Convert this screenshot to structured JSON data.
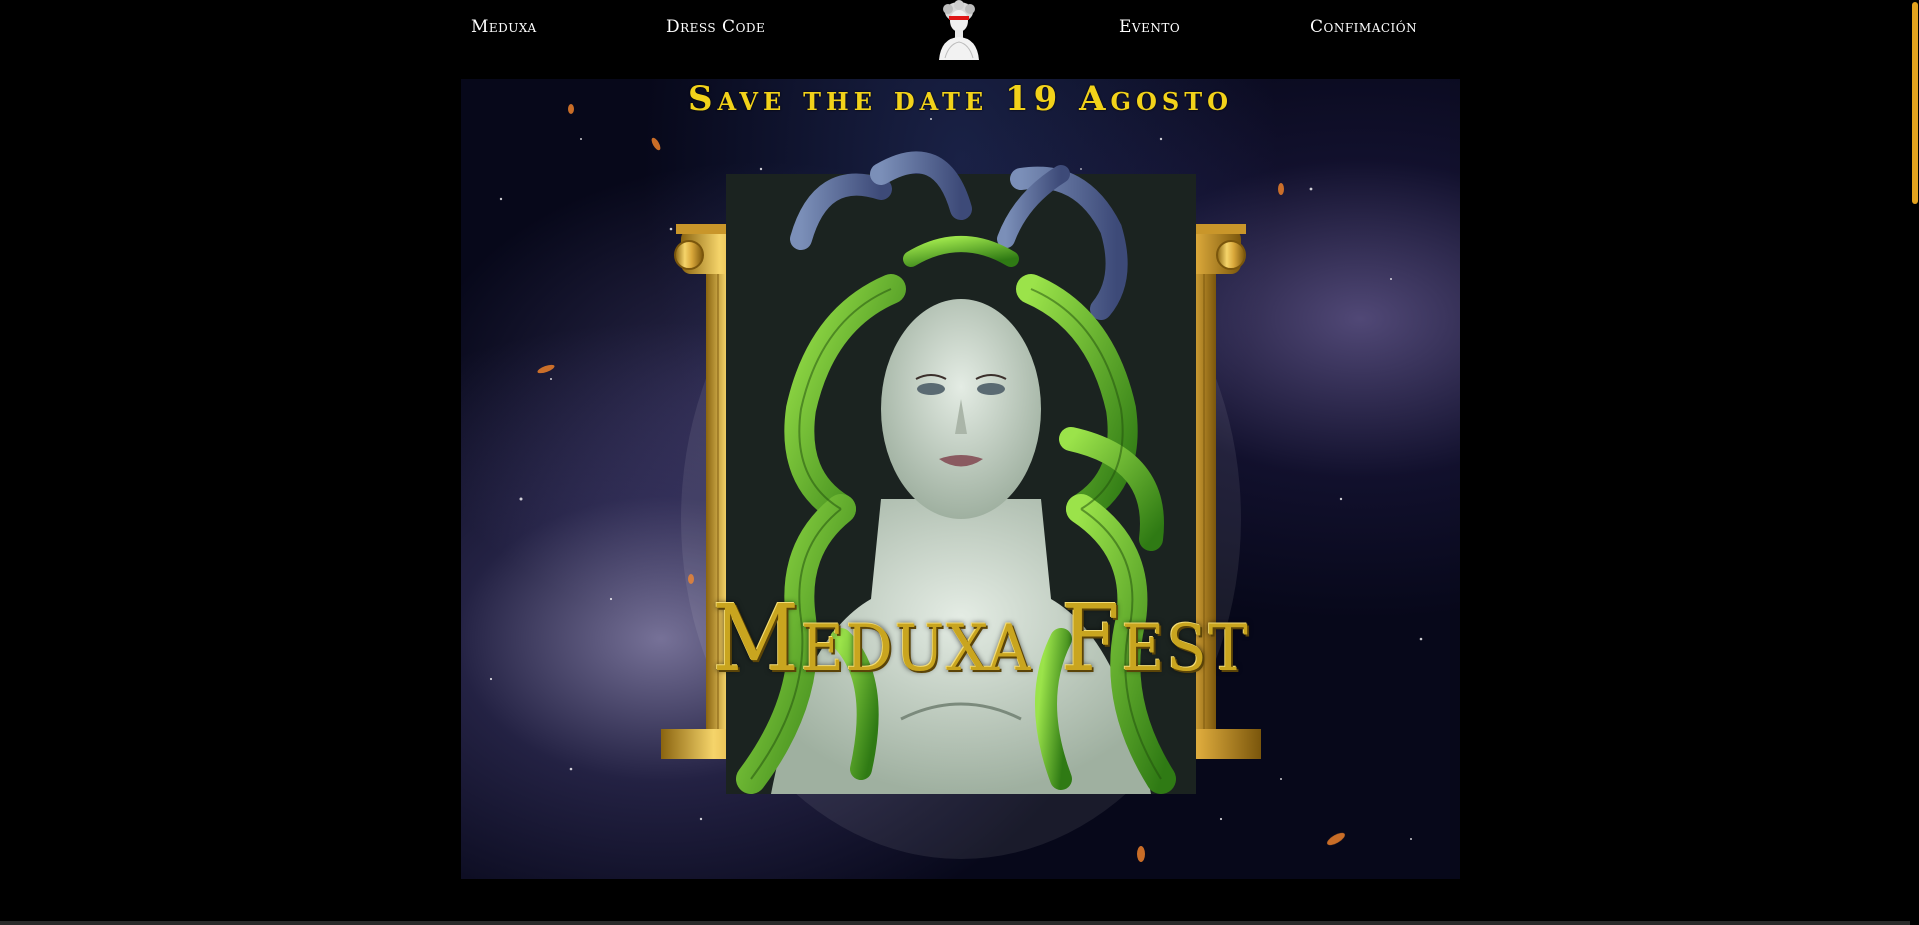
{
  "nav": {
    "items": [
      {
        "label": "Meduxa"
      },
      {
        "label": "Dress Code"
      },
      {
        "label": "Evento"
      },
      {
        "label": "Confimación"
      }
    ],
    "logo_icon": "medusa-bust-icon"
  },
  "hero": {
    "save_the_date": "Save the date 19  Agosto",
    "title": "Meduxa Fest",
    "image": "medusa-with-golden-columns-illustration"
  },
  "colors": {
    "background": "#000000",
    "accent_yellow": "#f2d21a",
    "gold": "#c9a51f",
    "snake_green": "#5fb52a",
    "scroll_thumb": "#e3a21e"
  }
}
